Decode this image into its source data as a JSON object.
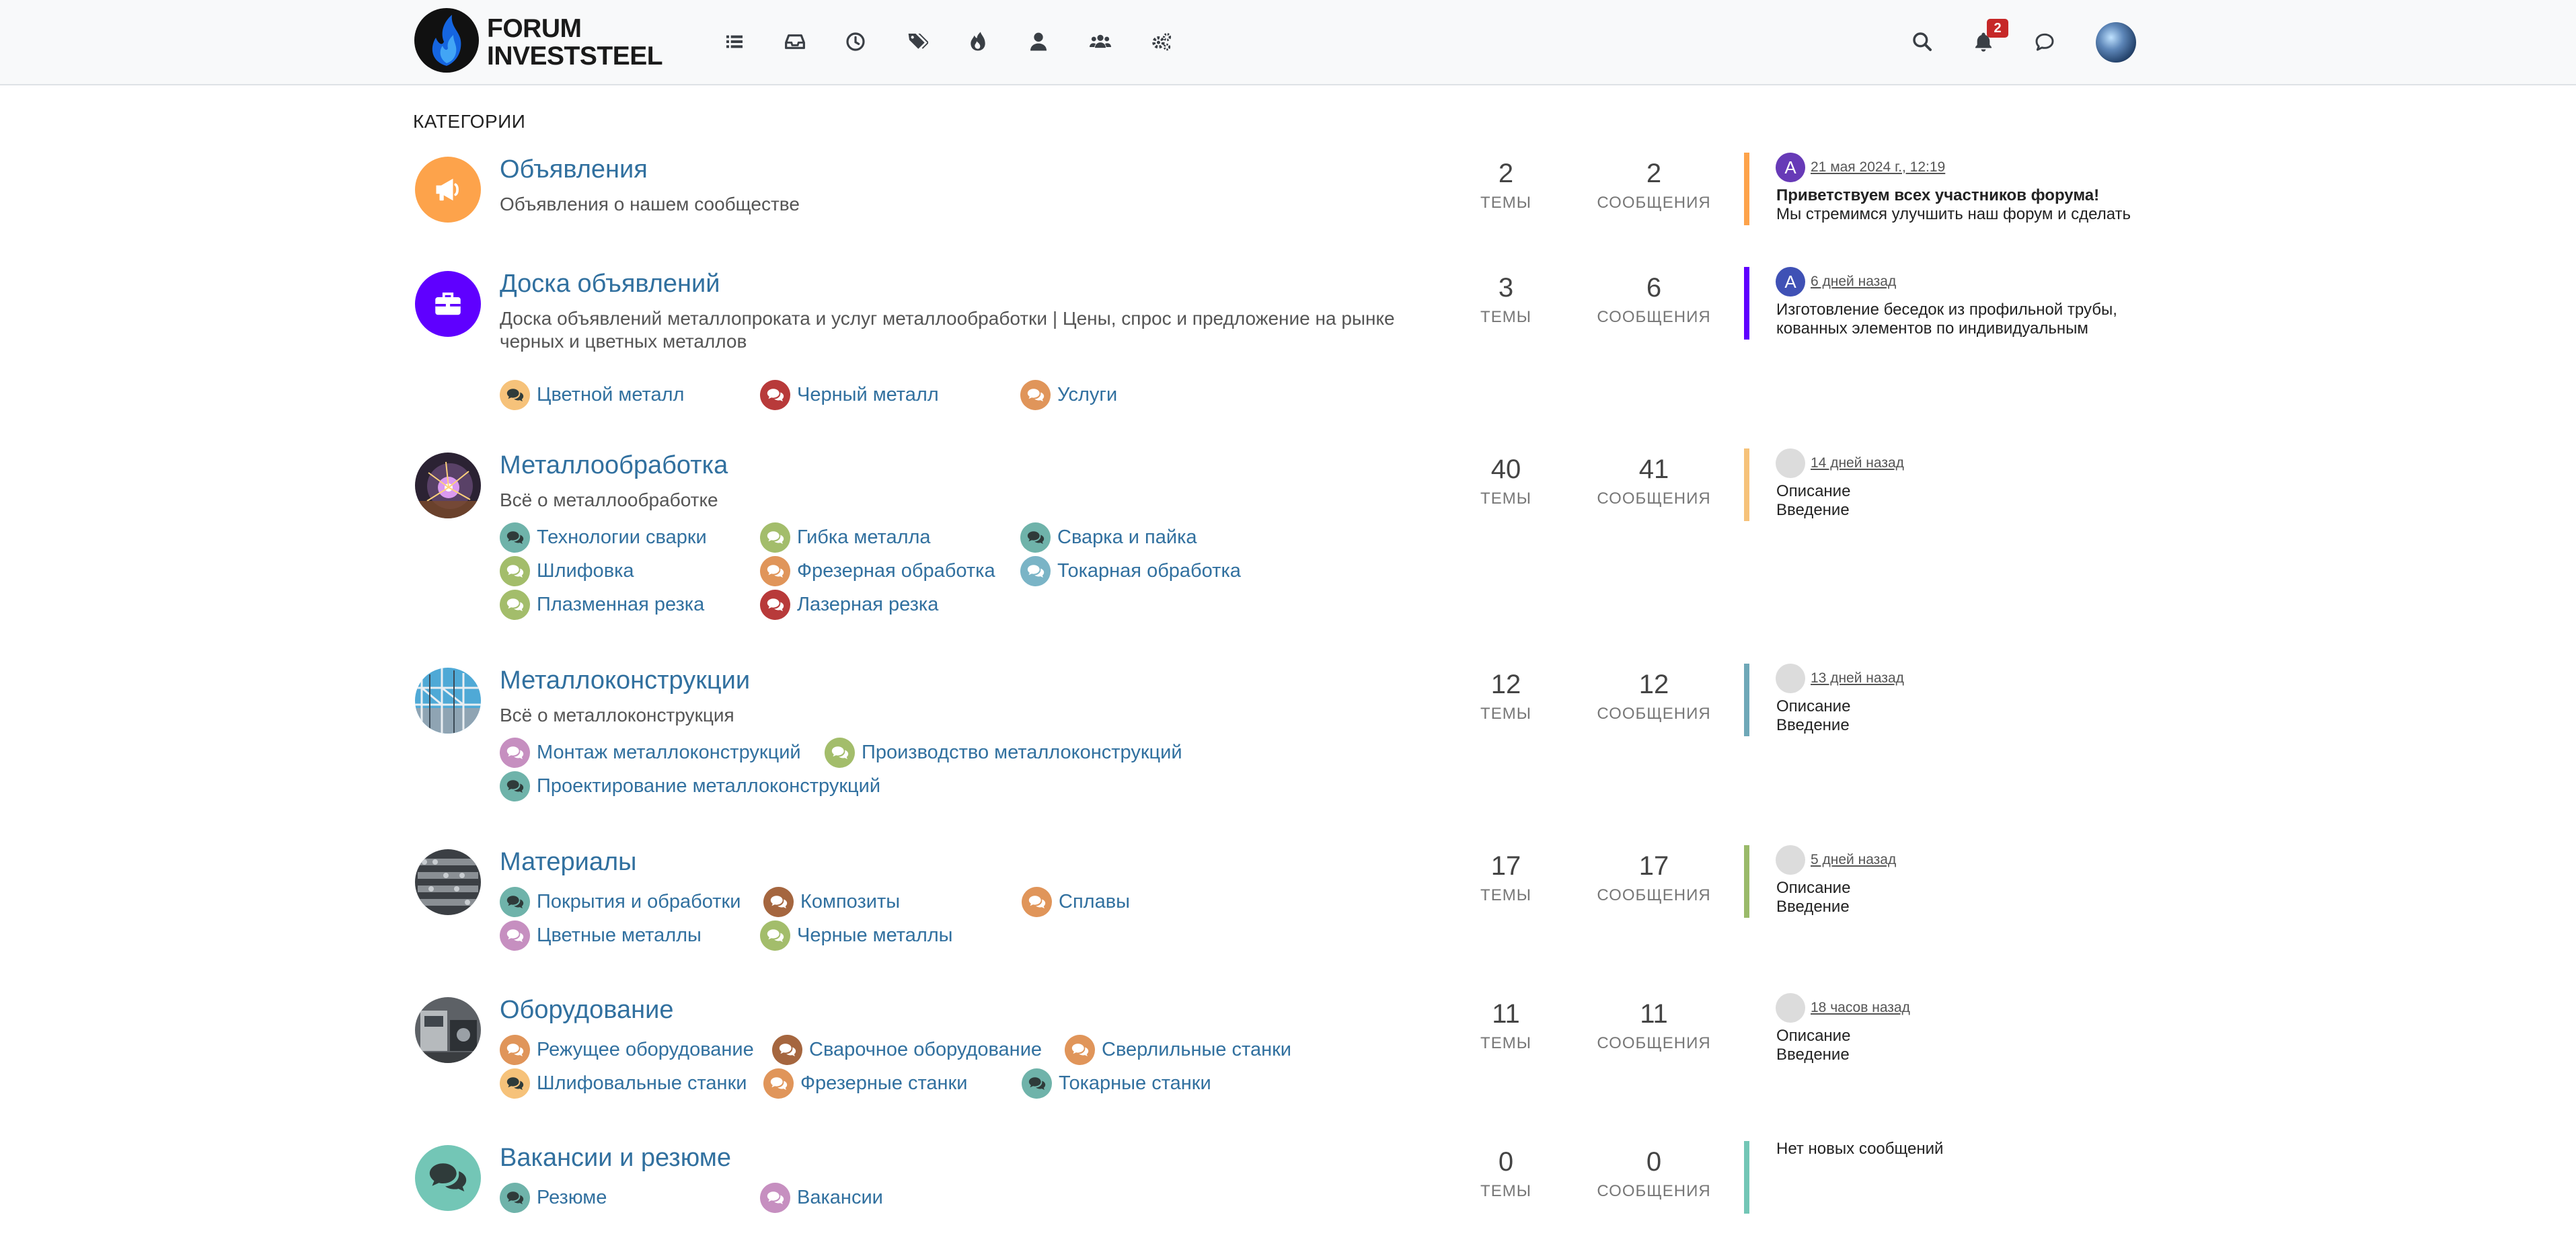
{
  "header": {
    "logo_line1": "FORUM",
    "logo_line2": "INVESTSTEEL",
    "nav_icons": [
      "categories-icon",
      "inbox-icon",
      "recent-icon",
      "tags-icon",
      "popular-icon",
      "user-icon",
      "groups-icon",
      "admin-icon"
    ],
    "notification_count": "2"
  },
  "main": {
    "section_title": "КАТЕГОРИИ"
  },
  "labels": {
    "topics": "ТЕМЫ",
    "posts": "СООБЩЕНИЯ"
  },
  "categories": [
    {
      "title": "Объявления",
      "description": "Объявления о нашем сообществе",
      "icon": "bullhorn-icon",
      "color": "#fda34b",
      "topics": "2",
      "posts": "2",
      "teaser": {
        "avatar_letter": "A",
        "avatar_color": "#673ab7",
        "time": "21 мая 2024 г., 12:19",
        "line1": "Приветствуем всех участников форума!",
        "line2": "Мы стремимся улучшить наш форум и сделать"
      },
      "subcategories": []
    },
    {
      "title": "Доска объявлений",
      "description": "Доска объявлений металлопроката и услуг металлообработки | Цены, спрос и предложение на рынке черных и цветных металлов",
      "icon": "briefcase-icon",
      "color": "#5f00ff",
      "topics": "3",
      "posts": "6",
      "teaser": {
        "avatar_letter": "A",
        "avatar_color": "#3f51b5",
        "time": "6 дней назад",
        "line1": "Изготовление беседок из профильной трубы,",
        "line2": "кованных элементов по индивидуальным"
      },
      "subcategories": [
        {
          "label": "Цветной металл",
          "color": "#f6c27a",
          "icon": "dark"
        },
        {
          "label": "Черный металл",
          "color": "#b83a3a",
          "icon": "light"
        },
        {
          "label": "Услуги",
          "color": "#e0955a",
          "icon": "light"
        }
      ]
    },
    {
      "title": "Металлообработка",
      "description": "Всё о металлообработке",
      "icon": "metalwork-photo",
      "color": "#f6c27a",
      "topics": "40",
      "posts": "41",
      "teaser": {
        "avatar_letter": "",
        "avatar_color": "#dcdcdc",
        "time": "14 дней назад",
        "line1": "Описание",
        "line2": "Введение"
      },
      "subcategories": [
        {
          "label": "Технологии сварки",
          "color": "#6fb3aa",
          "icon": "dark"
        },
        {
          "label": "Гибка металла",
          "color": "#a3bd6b",
          "icon": "light"
        },
        {
          "label": "Сварка и пайка",
          "color": "#6fb3aa",
          "icon": "dark"
        },
        {
          "label": "Шлифовка",
          "color": "#a3bd6b",
          "icon": "light"
        },
        {
          "label": "Фрезерная обработка",
          "color": "#e0955a",
          "icon": "light"
        },
        {
          "label": "Токарная обработка",
          "color": "#7ab4c6",
          "icon": "light"
        },
        {
          "label": "Плазменная резка",
          "color": "#a3bd6b",
          "icon": "light"
        },
        {
          "label": "Лазерная резка",
          "color": "#b83a3a",
          "icon": "light"
        }
      ]
    },
    {
      "title": "Металлоконструкции",
      "description": "Всё о металлоконструкция",
      "icon": "structures-photo",
      "color": "#6fa8b8",
      "topics": "12",
      "posts": "12",
      "teaser": {
        "avatar_letter": "",
        "avatar_color": "#dcdcdc",
        "time": "13 дней назад",
        "line1": "Описание",
        "line2": "Введение"
      },
      "subcategories": [
        {
          "label": "Монтаж металлоконструкций",
          "color": "#c68fc0",
          "icon": "light"
        },
        {
          "label": "Производство металлоконструкций",
          "color": "#a3bd6b",
          "icon": "light"
        },
        {
          "label": "Проектирование металлоконструкций",
          "color": "#6fb3aa",
          "icon": "dark"
        }
      ]
    },
    {
      "title": "Материалы",
      "description": "",
      "icon": "materials-photo",
      "color": "#9aba6a",
      "topics": "17",
      "posts": "17",
      "teaser": {
        "avatar_letter": "",
        "avatar_color": "#dcdcdc",
        "time": "5 дней назад",
        "line1": "Описание",
        "line2": "Введение"
      },
      "subcategories": [
        {
          "label": "Покрытия и обработки",
          "color": "#6fb3aa",
          "icon": "dark"
        },
        {
          "label": "Композиты",
          "color": "#a5663f",
          "icon": "light"
        },
        {
          "label": "Сплавы",
          "color": "#e0955a",
          "icon": "light"
        },
        {
          "label": "Цветные металлы",
          "color": "#c68fc0",
          "icon": "light"
        },
        {
          "label": "Черные металлы",
          "color": "#a3bd6b",
          "icon": "light"
        }
      ]
    },
    {
      "title": "Оборудование",
      "description": "",
      "icon": "equipment-photo",
      "color": "#ffffff",
      "topics": "11",
      "posts": "11",
      "teaser": {
        "avatar_letter": "",
        "avatar_color": "#dcdcdc",
        "time": "18 часов назад",
        "line1": "Описание",
        "line2": "Введение"
      },
      "subcategories": [
        {
          "label": "Режущее оборудование",
          "color": "#e0955a",
          "icon": "light"
        },
        {
          "label": "Сварочное оборудование",
          "color": "#a5663f",
          "icon": "light"
        },
        {
          "label": "Сверлильные станки",
          "color": "#e0955a",
          "icon": "light"
        },
        {
          "label": "Шлифовальные станки",
          "color": "#f6c27a",
          "icon": "dark"
        },
        {
          "label": "Фрезерные станки",
          "color": "#e0955a",
          "icon": "light"
        },
        {
          "label": "Токарные станки",
          "color": "#6fb3aa",
          "icon": "dark"
        }
      ]
    },
    {
      "title": "Вакансии и резюме",
      "description": "",
      "icon": "comments-icon",
      "color": "#73c6b6",
      "topics": "0",
      "posts": "0",
      "teaser": {
        "avatar_letter": "",
        "avatar_color": "",
        "time": "",
        "line1": "Нет новых сообщений",
        "line2": ""
      },
      "subcategories": [
        {
          "label": "Резюме",
          "color": "#6fb3aa",
          "icon": "dark"
        },
        {
          "label": "Вакансии",
          "color": "#c68fc0",
          "icon": "light"
        }
      ]
    }
  ]
}
